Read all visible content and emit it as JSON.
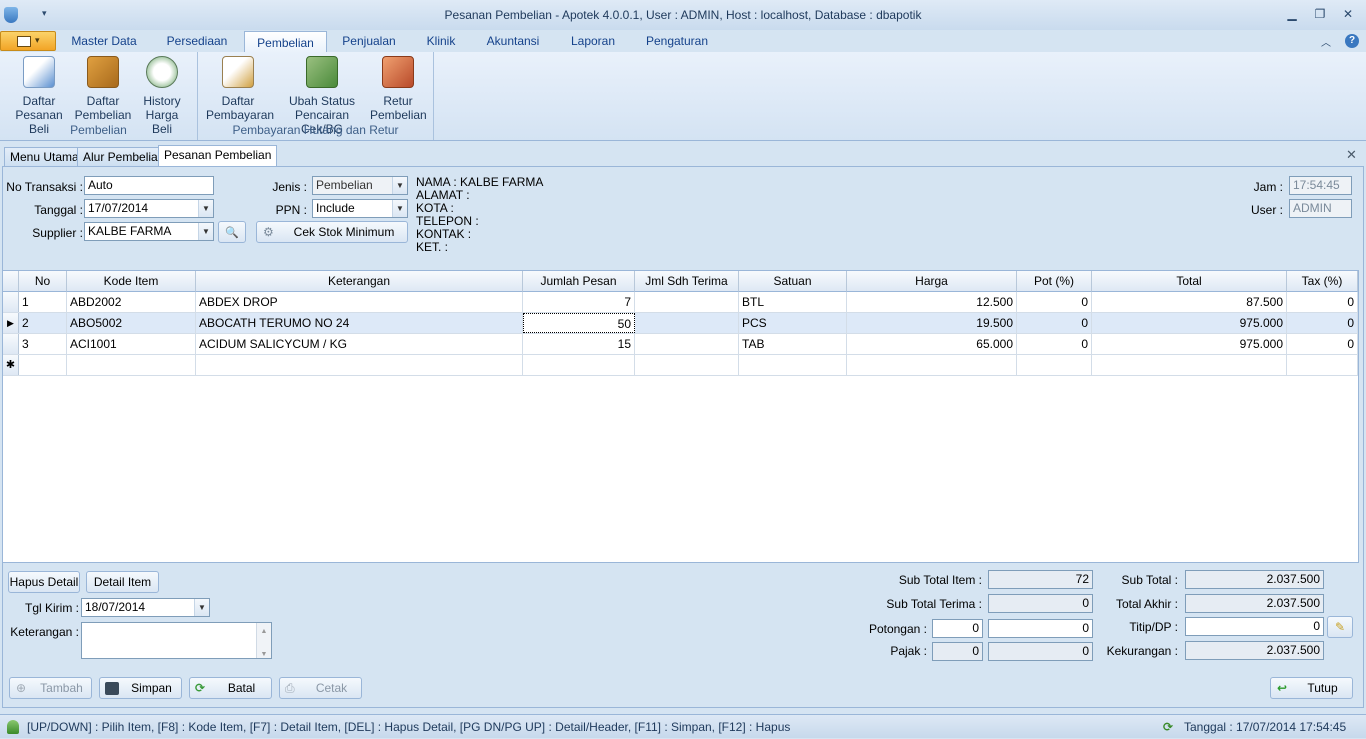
{
  "window": {
    "title": "Pesanan Pembelian - Apotek 4.0.0.1,  User : ADMIN, Host : localhost, Database : dbapotik"
  },
  "ribbon_tabs": [
    "Master Data",
    "Persediaan",
    "Pembelian",
    "Penjualan",
    "Klinik",
    "Akuntansi",
    "Laporan",
    "Pengaturan"
  ],
  "ribbon": {
    "group1": {
      "label": "Pembelian",
      "buttons": [
        {
          "line1": "Daftar",
          "line2": "Pesanan Beli"
        },
        {
          "line1": "Daftar",
          "line2": "Pembelian"
        },
        {
          "line1": "History",
          "line2": "Harga Beli"
        }
      ]
    },
    "group2": {
      "label": "Pembayaran Hutang dan Retur",
      "buttons": [
        {
          "line1": "Daftar",
          "line2": "Pembayaran"
        },
        {
          "line1": "Ubah Status",
          "line2": "Pencairan Cek/BG"
        },
        {
          "line1": "Retur",
          "line2": "Pembelian"
        }
      ]
    }
  },
  "doc_tabs": [
    "Menu Utama",
    "Alur Pembelian",
    "Pesanan Pembelian"
  ],
  "form": {
    "no_transaksi_label": "No Transaksi :",
    "no_transaksi": "Auto",
    "tanggal_label": "Tanggal :",
    "tanggal": "17/07/2014",
    "supplier_label": "Supplier :",
    "supplier": "KALBE FARMA",
    "jenis_label": "Jenis :",
    "jenis": "Pembelian",
    "ppn_label": "PPN :",
    "ppn": "Include",
    "cek_stok_label": "Cek Stok Minimum",
    "jam_label": "Jam :",
    "jam": "17:54:45",
    "user_label": "User :",
    "user": "ADMIN"
  },
  "supplier_info": [
    "NAMA : KALBE FARMA",
    "ALAMAT :",
    "KOTA :",
    "TELEPON :",
    "KONTAK :",
    "KET. :"
  ],
  "grid": {
    "headers": [
      "No",
      "Kode Item",
      "Keterangan",
      "Jumlah Pesan",
      "Jml Sdh Terima",
      "Satuan",
      "Harga",
      "Pot (%)",
      "Total",
      "Tax (%)"
    ],
    "rows": [
      {
        "no": "1",
        "kode": "ABD2002",
        "ket": "ABDEX DROP",
        "jumlah": "7",
        "terima": "",
        "satuan": "BTL",
        "harga": "12.500",
        "pot": "0",
        "total": "87.500",
        "tax": "0"
      },
      {
        "no": "2",
        "kode": "ABO5002",
        "ket": "ABOCATH TERUMO NO 24",
        "jumlah": "50",
        "terima": "",
        "satuan": "PCS",
        "harga": "19.500",
        "pot": "0",
        "total": "975.000",
        "tax": "0"
      },
      {
        "no": "3",
        "kode": "ACI1001",
        "ket": "ACIDUM SALICYCUM / KG",
        "jumlah": "15",
        "terima": "",
        "satuan": "TAB",
        "harga": "65.000",
        "pot": "0",
        "total": "975.000",
        "tax": "0"
      }
    ]
  },
  "bottom": {
    "hapus_detail": "Hapus Detail",
    "detail_item": "Detail Item",
    "tgl_kirim_label": "Tgl Kirim :",
    "tgl_kirim": "18/07/2014",
    "keterangan_label": "Keterangan :",
    "sub_total_item_label": "Sub Total Item :",
    "sub_total_item": "72",
    "sub_total_terima_label": "Sub Total Terima :",
    "sub_total_terima": "0",
    "potongan_label": "Potongan :",
    "potongan_pct": "0",
    "potongan": "0",
    "pajak_label": "Pajak :",
    "pajak_pct": "0",
    "pajak": "0",
    "sub_total_label": "Sub Total :",
    "sub_total": "2.037.500",
    "total_akhir_label": "Total Akhir :",
    "total_akhir": "2.037.500",
    "titip_label": "Titip/DP :",
    "titip": "0",
    "kekurangan_label": "Kekurangan :",
    "kekurangan": "2.037.500",
    "tambah": "Tambah",
    "simpan": "Simpan",
    "batal": "Batal",
    "cetak": "Cetak",
    "tutup": "Tutup"
  },
  "status": {
    "shortcuts": "[UP/DOWN] : Pilih Item, [F8] : Kode Item, [F7] : Detail Item, [DEL] : Hapus Detail, [PG DN/PG UP] : Detail/Header, [F11] : Simpan, [F12] : Hapus",
    "tanggal": "Tanggal : 17/07/2014 17:54:45"
  },
  "colors": {
    "accent": "#15428b",
    "ribbon_bg": "#d5e4f2",
    "app_button": "#f2a426"
  }
}
